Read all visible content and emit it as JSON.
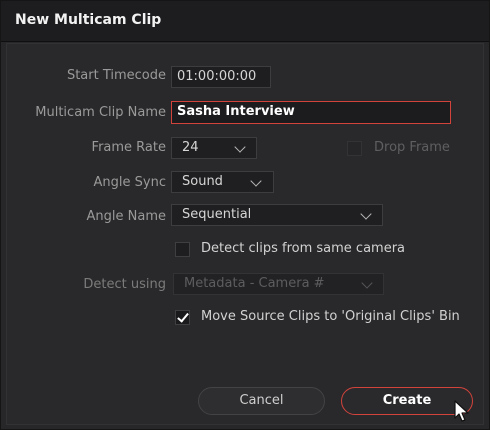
{
  "title": "New Multicam Clip",
  "start_timecode": {
    "label": "Start Timecode",
    "value": "01:00:00:00"
  },
  "clip_name": {
    "label": "Multicam Clip Name",
    "value": "Sasha Interview"
  },
  "frame_rate": {
    "label": "Frame Rate",
    "value": "24"
  },
  "drop_frame": {
    "label": "Drop Frame",
    "checked": false,
    "enabled": false
  },
  "angle_sync": {
    "label": "Angle Sync",
    "value": "Sound"
  },
  "angle_name": {
    "label": "Angle Name",
    "value": "Sequential"
  },
  "detect_same_camera": {
    "label": "Detect clips from same camera",
    "checked": false
  },
  "detect_using": {
    "label": "Detect using",
    "value": "Metadata - Camera #",
    "enabled": false
  },
  "move_source": {
    "label": "Move Source Clips to 'Original Clips' Bin",
    "checked": true
  },
  "buttons": {
    "cancel": "Cancel",
    "create": "Create"
  },
  "colors": {
    "accent": "#d2433c",
    "background": "#29292b",
    "title_bar": "#1d1d1f"
  }
}
